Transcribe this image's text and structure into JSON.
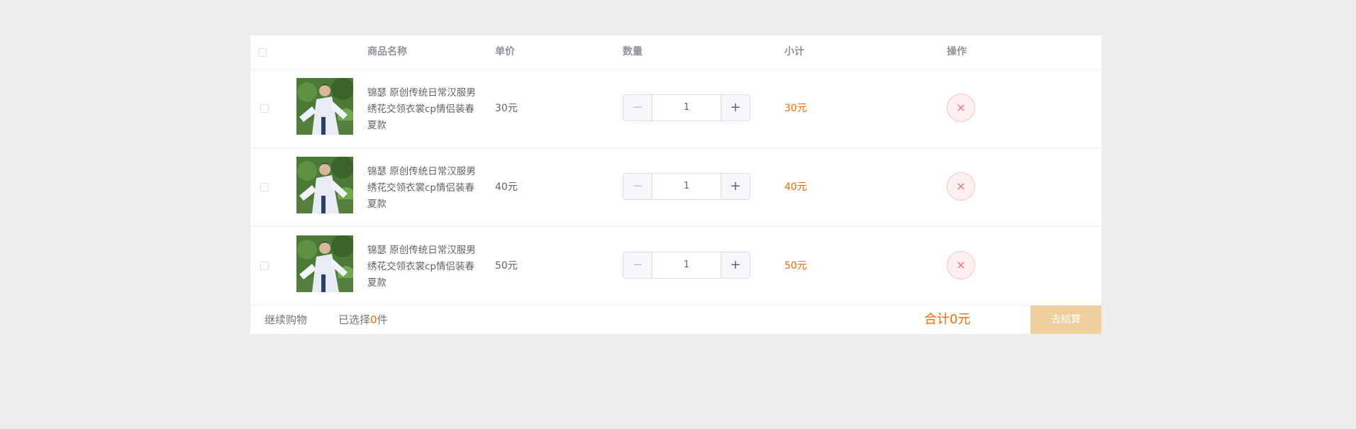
{
  "colors": {
    "accent": "#ff6700",
    "page_background": "#ededed",
    "checkout_disabled": "#f0ce9e",
    "delete": "#f56c6c"
  },
  "header": {
    "select_all_checked": false,
    "product_name": "商品名称",
    "unit_price": "单价",
    "quantity": "数量",
    "subtotal": "小计",
    "action": "操作"
  },
  "items": [
    {
      "checked": false,
      "name_lines": [
        "锦瑟 原创传统日常汉服男",
        "绣花交领衣裳cp情侣装春",
        "夏款"
      ],
      "price": "30元",
      "quantity": "1",
      "subtotal": "30元",
      "decrement": "−",
      "increment": "+",
      "delete_icon": "×"
    },
    {
      "checked": false,
      "name_lines": [
        "锦瑟 原创传统日常汉服男",
        "绣花交领衣裳cp情侣装春",
        "夏款"
      ],
      "price": "40元",
      "quantity": "1",
      "subtotal": "40元",
      "decrement": "−",
      "increment": "+",
      "delete_icon": "×"
    },
    {
      "checked": false,
      "name_lines": [
        "锦瑟 原创传统日常汉服男",
        "绣花交领衣裳cp情侣装春",
        "夏款"
      ],
      "price": "50元",
      "quantity": "1",
      "subtotal": "50元",
      "decrement": "−",
      "increment": "+",
      "delete_icon": "×"
    }
  ],
  "footer": {
    "continue_shopping": "继续购物",
    "selected_prefix": "已选择",
    "selected_count": "0",
    "selected_suffix": "件",
    "total": "合计0元",
    "checkout": "去结算"
  }
}
